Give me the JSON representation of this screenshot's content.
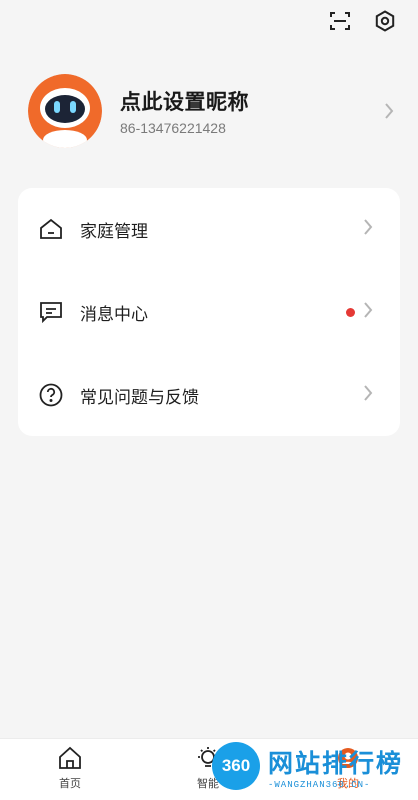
{
  "profile": {
    "nickname": "点此设置昵称",
    "phone": "86-13476221428"
  },
  "menu": [
    {
      "label": "家庭管理",
      "icon": "home-outline-icon",
      "unread": false
    },
    {
      "label": "消息中心",
      "icon": "message-icon",
      "unread": true
    },
    {
      "label": "常见问题与反馈",
      "icon": "help-circle-icon",
      "unread": false
    }
  ],
  "tabbar": {
    "tabs": [
      {
        "label": "首页",
        "icon": "home-icon",
        "active": false
      },
      {
        "label": "智能",
        "icon": "bulb-icon",
        "active": false
      },
      {
        "label": "我的",
        "icon": "user-icon",
        "active": true
      }
    ]
  },
  "watermark": {
    "logo": "360",
    "text": "网站排行榜",
    "sub": "-WANGZHAN360.CN-"
  },
  "colors": {
    "accent": "#e45a1f",
    "unread_dot": "#e53935",
    "background": "#f5f5f5",
    "card": "#ffffff"
  }
}
